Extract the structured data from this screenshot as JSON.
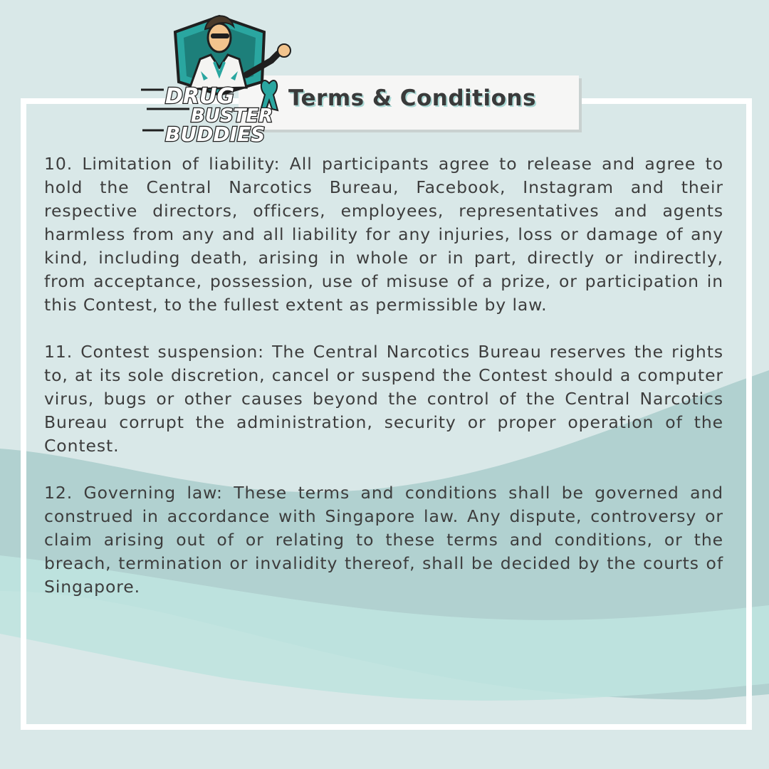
{
  "logo": {
    "line1": "DRUG",
    "line2": "BUSTER",
    "line3": "BUDDIES"
  },
  "header": {
    "title": "Terms & Conditions"
  },
  "clauses": [
    {
      "text": "10. Limitation of liability: All participants agree to release and agree to hold the Central Narcotics Bureau, Facebook, Instagram and their respective directors, officers, employees, representatives and agents harmless from any and all liability for any injuries, loss or damage of any kind, including death, arising in whole or in part, directly or indirectly, from acceptance, possession, use of misuse of a prize, or participation in this Contest, to the fullest extent as permissible by law."
    },
    {
      "text": "11. Contest suspension: The Central Narcotics Bureau reserves the rights to, at its sole discretion, cancel or suspend the Contest should a computer virus, bugs or other causes beyond the control of the Central Narcotics Bureau corrupt the administration, security or proper operation of the Contest."
    },
    {
      "text": "12. Governing law: These terms and conditions shall be governed and construed in accordance with Singapore law. Any dispute, controversy or claim arising out of or relating to these terms and conditions, or the breach, termination or invalidity thereof, shall be decided by the courts of Singapore."
    }
  ],
  "colors": {
    "background": "#d9e8e8",
    "wave_dark": "#a9cccb",
    "wave_light": "#bfe3df",
    "frame": "#ffffff",
    "logo_teal": "#2aa6a0",
    "text": "#3d3d3d"
  }
}
